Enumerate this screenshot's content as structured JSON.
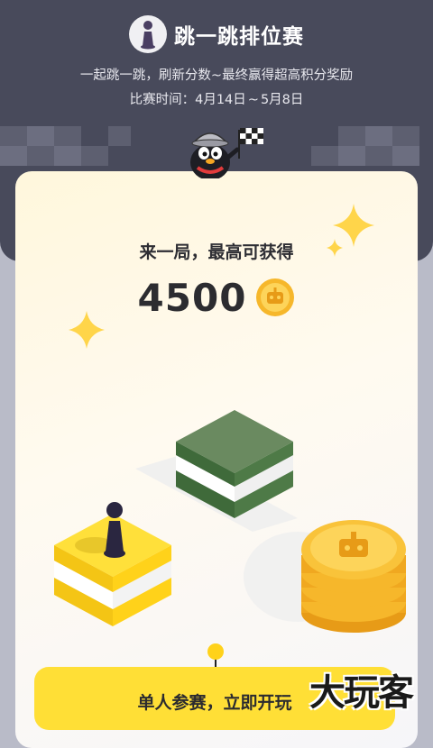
{
  "header": {
    "title": "跳一跳排位赛",
    "logo_icon": "jump-chess-piece-icon",
    "subtitle": "一起跳一跳，刷新分数~最终赢得超高积分奖励",
    "period_label": "比赛时间：",
    "period_start": "4月14日",
    "period_sep": "~",
    "period_end": "5月8日"
  },
  "card": {
    "reward_label": "来一局，最高可获得",
    "reward_value": "4500",
    "reward_icon": "robot-coin-icon"
  },
  "cta": {
    "label": "单人参赛，立即开玩"
  },
  "watermark": {
    "text": "大玩客"
  },
  "colors": {
    "header_bg": "#484a5b",
    "page_bg": "#b9bbc8",
    "cta_bg": "#ffdf36",
    "coin": "#f6b72b",
    "sparkle": "#ffd54a",
    "green_block": "#6a8a60",
    "yellow_block": "#ffe03a"
  }
}
